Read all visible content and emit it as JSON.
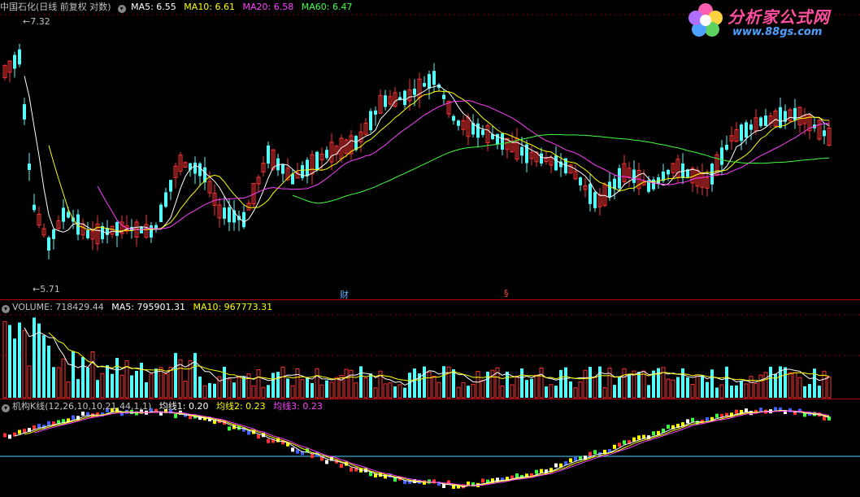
{
  "main": {
    "stock_title": "中国石化(日线 前复权 对数)",
    "ma": [
      {
        "label": "MA5: 6.55",
        "color": "#ffffff"
      },
      {
        "label": "MA10: 6.61",
        "color": "#ffff00"
      },
      {
        "label": "MA20: 6.58",
        "color": "#ff40ff"
      },
      {
        "label": "MA60: 6.47",
        "color": "#40ff40"
      }
    ],
    "high_label": "7.32",
    "low_label": "5.71",
    "event_cai": "财",
    "event_s": "§"
  },
  "volume": {
    "label": "VOLUME: 718429.44",
    "ma5": "MA5: 795901.31",
    "ma10": "MA10: 967773.31"
  },
  "indicator": {
    "label": "机构K线(12,26,10,10,21,44,1,1)",
    "line1": "均线1: 0.20",
    "line2": "均线2: 0.23",
    "line3": "均线3: 0.23"
  },
  "logo": {
    "brand": "分析家公式网",
    "url": "www.88gs.com"
  },
  "colors": {
    "up": "#ff3232",
    "down": "#54fcfc",
    "ma5": "#ffffff",
    "ma10": "#ffff00",
    "ma20": "#ff40ff",
    "ma60": "#40ff40",
    "grid": "#800000",
    "separator": "#b00000"
  }
}
